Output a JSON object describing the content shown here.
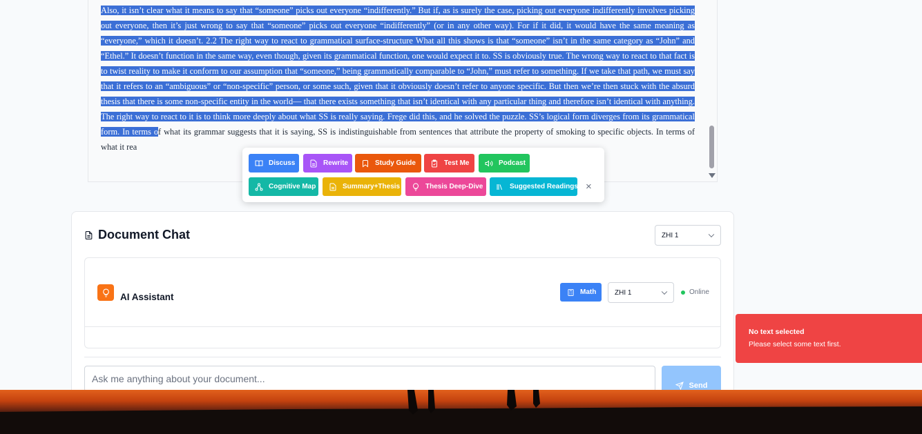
{
  "document": {
    "selected_text": "we just saw, “someone smokes, but John does not” is not self-contradictory under any circumstances. If John does smoke, it will be false, but it won’t be self-contradictory. Also, it isn’t clear what it means to say that “someone” picks out everyone “indifferently.” But if, as is surely the case, picking out everyone indifferently involves picking out everyone, then it’s just wrong to say that “someone” picks out everyone “indifferently” (or in any other way). For if it did, it would have the same meaning as “everyone,” which it doesn’t. 2.2 The right way to react to grammatical surface-structure What all this shows is that “someone” isn’t in the same category as “John” and “Ethel.” It doesn’t function in the same way, even though, given its grammatical function, one would expect it to. SS is obviously true. The wrong way to react to that fact is to twist reality to make it conform to our assumption that “someone,” being grammatically comparable to “John,” must refer to something. If we take that path, we must say that it refers to an “ambiguous” or “non-specific” person, or some such, given that it obviously doesn’t refer to anyone specific. But then we’re then stuck with the absurd thesis that there is some non-specific entity in the world— that there exists something that isn’t identical with any particular thing and therefore isn’t identical with anything. The right way to react to it is to think more deeply about what SS is really saying. Frege did this, and he solved the puzzle. SS’s logical form diverges from its grammatical form. In terms o",
    "unselected_text": "f what its grammar suggests that it is saying, SS is indistinguishable from sentences that attribute the property of smoking to specific objects. In terms of what it rea"
  },
  "toolbar": {
    "buttons": [
      {
        "label": "Discuss",
        "icon": "book-open-icon",
        "color": "#3b82f6"
      },
      {
        "label": "Rewrite",
        "icon": "file-text-icon",
        "color": "#a855f7"
      },
      {
        "label": "Study Guide",
        "icon": "bookmark-icon",
        "color": "#ea580c"
      },
      {
        "label": "Test Me",
        "icon": "clipboard-check-icon",
        "color": "#ef4444"
      },
      {
        "label": "Podcast",
        "icon": "speaker-icon",
        "color": "#22c55e"
      },
      {
        "label": "Cognitive Map",
        "icon": "network-icon",
        "color": "#14b8a6"
      },
      {
        "label": "Summary+Thesis",
        "icon": "file-text-icon",
        "color": "#eab308"
      },
      {
        "label": "Thesis Deep-Dive",
        "icon": "lightbulb-icon",
        "color": "#ec4899"
      },
      {
        "label": "Suggested Readings",
        "icon": "library-icon",
        "color": "#06b6d4"
      }
    ],
    "close_label": "×"
  },
  "chat": {
    "title": "Document Chat",
    "model_select": "ZHI 1",
    "assistant_name": "AI Assistant",
    "math_label": "Math",
    "assistant_model_select": "ZHI 1",
    "status": "Online",
    "input_placeholder": "Ask me anything about your document...",
    "send_label": "Send"
  },
  "toast": {
    "title": "No text selected",
    "message": "Please select some text first."
  }
}
